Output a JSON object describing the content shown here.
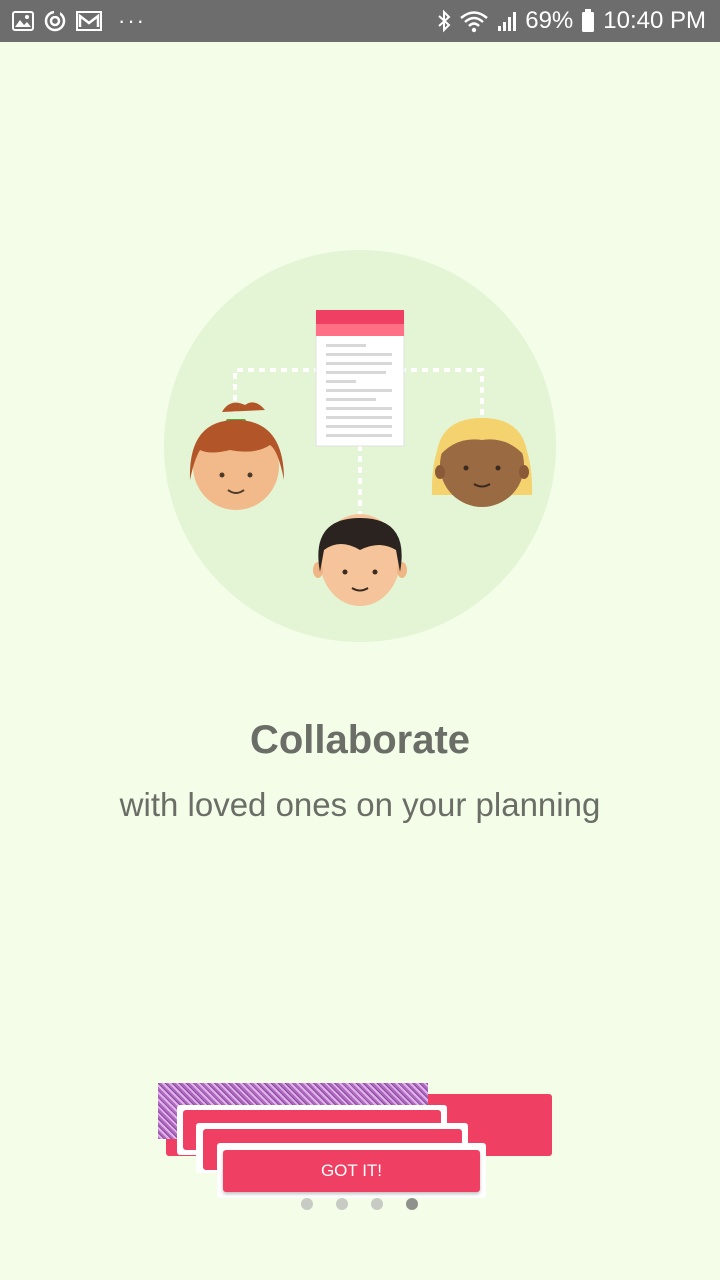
{
  "status_bar": {
    "notification_icons": [
      "gallery-icon",
      "sync-icon",
      "mail-icon"
    ],
    "more_dots": "···",
    "battery_percent": "69%",
    "time": "10:40 PM"
  },
  "onboarding": {
    "title": "Collaborate",
    "subtitle": "with loved ones on your planning",
    "button_label": "GOT IT!",
    "page_count": 4,
    "current_page": 4
  },
  "colors": {
    "background": "#f3fde8",
    "accent": "#ef3f63",
    "text": "#6a6e66",
    "status_bar": "#6d6d6d"
  }
}
